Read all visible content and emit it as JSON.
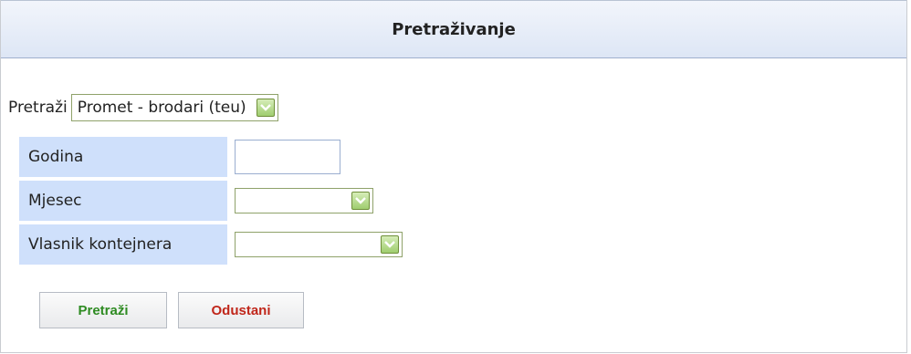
{
  "panel": {
    "title": "Pretraživanje"
  },
  "search": {
    "label": "Pretraži",
    "selected": "Promet - brodari (teu)"
  },
  "form": {
    "fields": [
      {
        "label": "Godina",
        "value": ""
      },
      {
        "label": "Mjesec",
        "value": ""
      },
      {
        "label": "Vlasnik kontejnera",
        "value": ""
      }
    ]
  },
  "buttons": {
    "search_label": "Pretraži",
    "cancel_label": "Odustani"
  },
  "colors": {
    "header_bg": "#dde6f5",
    "label_cell_bg": "#cfe0fb",
    "search_text": "#2e8b22",
    "cancel_text": "#c0261a",
    "dropdown_green": "#9fcd6f"
  }
}
